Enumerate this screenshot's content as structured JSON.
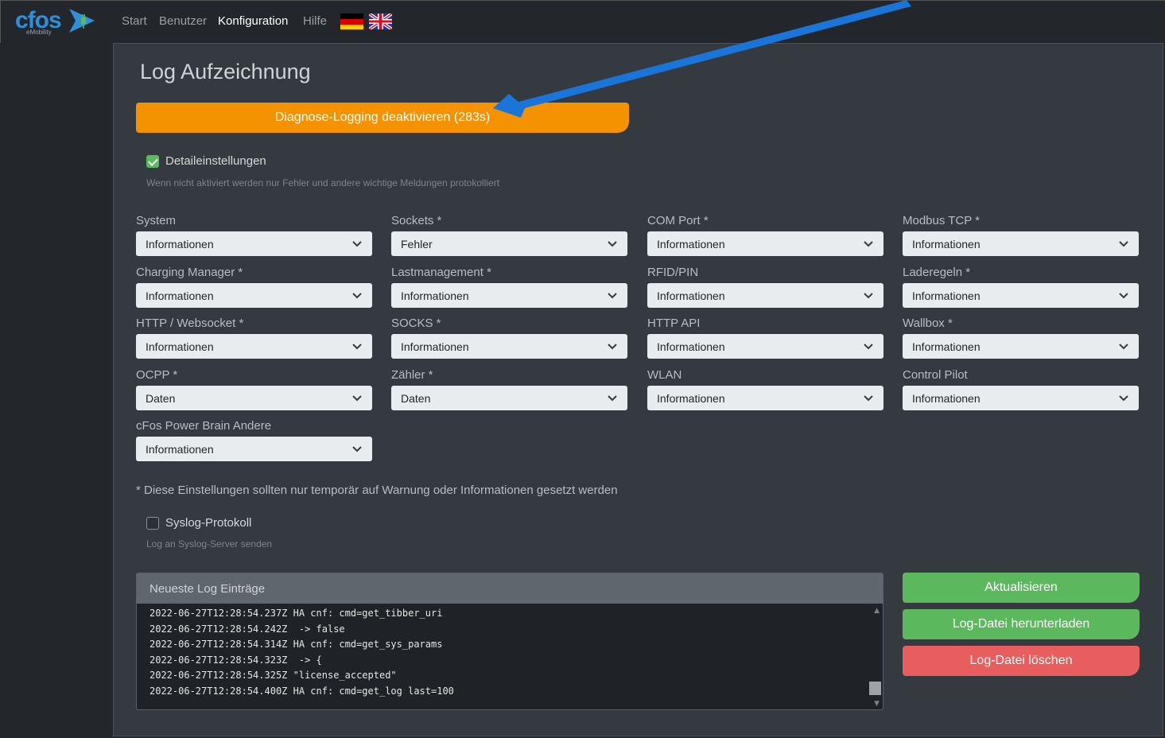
{
  "brand": {
    "logo_text": "cfos",
    "logo_sub": "eMobility"
  },
  "nav": [
    {
      "label": "Start"
    },
    {
      "label": "Benutzer"
    },
    {
      "label": "Konfiguration",
      "active": true
    },
    {
      "label": "Hilfe"
    }
  ],
  "flags": [
    "german-flag-icon",
    "uk-flag-icon"
  ],
  "page": {
    "title": "Log Aufzeichnung",
    "diag_button": "Diagnose-Logging deaktivieren (283s)",
    "details_label": "Detaileinstellungen",
    "details_checked": true,
    "details_hint": "Wenn nicht aktiviert werden nur Fehler und andere wichtige Meldungen protokolliert",
    "fields": [
      {
        "label": "System",
        "value": "Informationen"
      },
      {
        "label": "Sockets *",
        "value": "Fehler"
      },
      {
        "label": "COM Port *",
        "value": "Informationen"
      },
      {
        "label": "Modbus TCP *",
        "value": "Informationen"
      },
      {
        "label": "Charging Manager *",
        "value": "Informationen"
      },
      {
        "label": "Lastmanagement *",
        "value": "Informationen"
      },
      {
        "label": "RFID/PIN",
        "value": "Informationen"
      },
      {
        "label": "Laderegeln *",
        "value": "Informationen"
      },
      {
        "label": "HTTP / Websocket *",
        "value": "Informationen"
      },
      {
        "label": "SOCKS *",
        "value": "Informationen"
      },
      {
        "label": "HTTP API",
        "value": "Informationen"
      },
      {
        "label": "Wallbox *",
        "value": "Informationen"
      },
      {
        "label": "OCPP *",
        "value": "Daten"
      },
      {
        "label": "Zähler *",
        "value": "Daten"
      },
      {
        "label": "WLAN",
        "value": "Informationen"
      },
      {
        "label": "Control Pilot",
        "value": "Informationen"
      },
      {
        "label": "cFos Power Brain Andere",
        "value": "Informationen"
      }
    ],
    "note": "* Diese Einstellungen sollten nur temporär auf Warnung oder Informationen gesetzt werden",
    "syslog_label": "Syslog-Protokoll",
    "syslog_checked": false,
    "syslog_hint": "Log an Syslog-Server senden",
    "log_header": "Neueste Log Einträge",
    "log_lines": [
      "2022-06-27T12:28:54.237Z HA cnf: cmd=get_tibber_uri",
      "2022-06-27T12:28:54.242Z  -> false",
      "2022-06-27T12:28:54.314Z HA cnf: cmd=get_sys_params",
      "2022-06-27T12:28:54.323Z  -> {",
      "2022-06-27T12:28:54.325Z \"license_accepted\"",
      "2022-06-27T12:28:54.400Z HA cnf: cmd=get_log last=100"
    ],
    "btn_refresh": "Aktualisieren",
    "btn_download": "Log-Datei herunterladen",
    "btn_delete": "Log-Datei löschen"
  },
  "colors": {
    "accent_orange": "#f59202",
    "green": "#5cb85c",
    "red": "#e85d5d",
    "annotation_arrow": "#1b74d8"
  }
}
